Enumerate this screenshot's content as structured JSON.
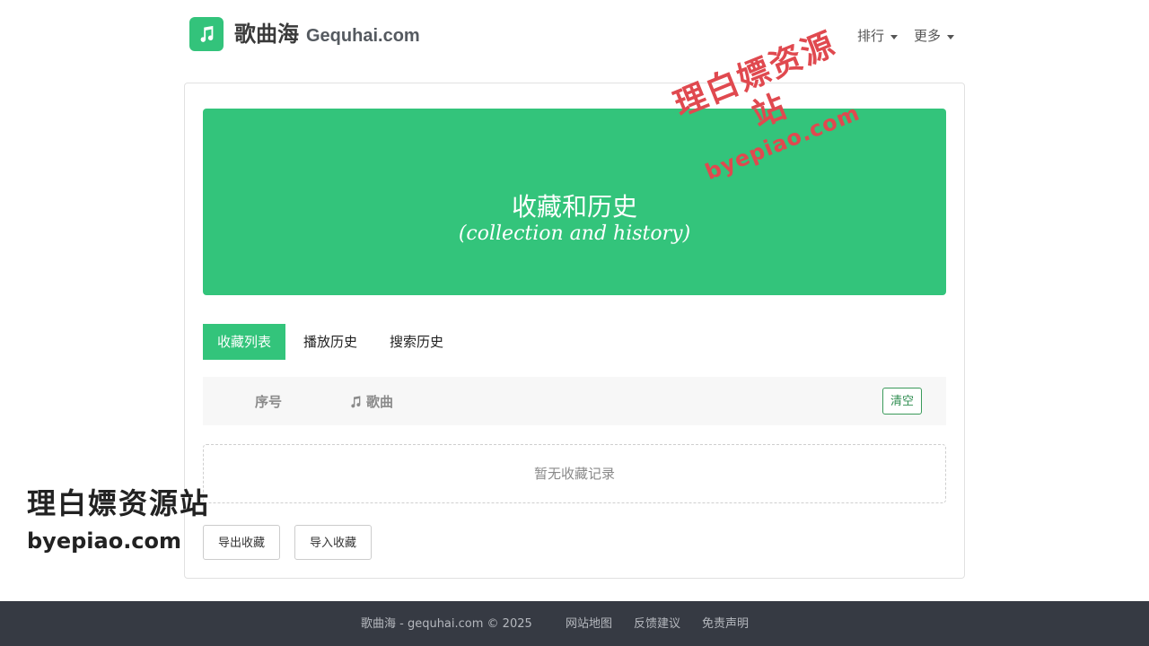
{
  "header": {
    "brand_cn": "歌曲海",
    "brand_en": "Gequhai.com",
    "nav": [
      {
        "label": "排行"
      },
      {
        "label": "更多"
      }
    ]
  },
  "hero": {
    "title": "收藏和历史",
    "subtitle": "(collection and history)"
  },
  "tabs": [
    {
      "label": "收藏列表",
      "active": true
    },
    {
      "label": "播放历史",
      "active": false
    },
    {
      "label": "搜索历史",
      "active": false
    }
  ],
  "table": {
    "col_index": "序号",
    "col_song": "歌曲",
    "clear_label": "清空",
    "empty_text": "暂无收藏记录"
  },
  "actions": {
    "export_label": "导出收藏",
    "import_label": "导入收藏"
  },
  "footer": {
    "copyright": "歌曲海 - gequhai.com © 2025",
    "links": [
      "网站地图",
      "反馈建议",
      "免责声明"
    ]
  },
  "watermark": {
    "stamp_line1": "理白嫖资源站",
    "stamp_line2": "byepiao.com",
    "corner_line1": "理白嫖资源站",
    "corner_line2": "byepiao.com"
  },
  "colors": {
    "accent": "#33c47b",
    "footer_bg": "#363a43",
    "watermark_red": "#e0494f"
  },
  "icons": {
    "logo": "music-note-icon",
    "song_column": "music-note-icon",
    "nav_caret": "caret-down-icon"
  }
}
